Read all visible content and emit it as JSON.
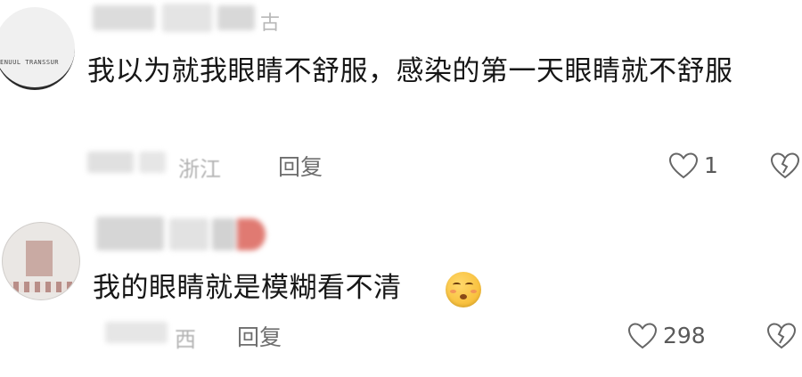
{
  "comments": [
    {
      "avatar_text": "ENUUL TRANSSUR",
      "username_tail": "古",
      "text": "我以为就我眼睛不舒服，感染的第一天眼睛就不舒服",
      "location": "浙江",
      "reply_label": "回复",
      "like_count": "1",
      "like_icon": "heart-outline-icon",
      "dislike_icon": "broken-heart-icon"
    },
    {
      "username_tail": "",
      "text": "我的眼睛就是模糊看不清",
      "emoji": "dizzy-face-emoji",
      "location": "西",
      "reply_label": "回复",
      "like_count": "298",
      "like_icon": "heart-outline-icon",
      "dislike_icon": "broken-heart-icon"
    }
  ],
  "colors": {
    "text": "#161616",
    "meta": "#6e6e6e",
    "muted": "#b3b3b3",
    "background": "#ffffff"
  }
}
